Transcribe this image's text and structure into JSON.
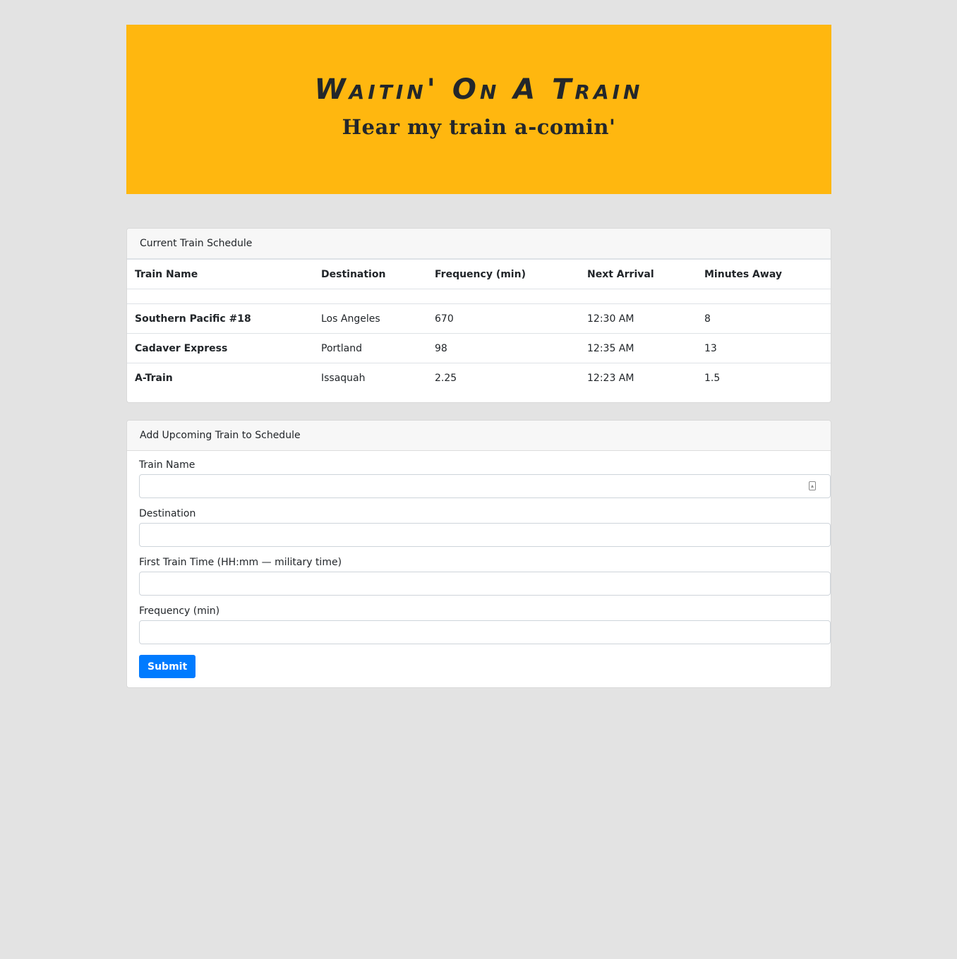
{
  "header": {
    "title": "Waitin' On A Train",
    "subtitle": "Hear my train a-comin'"
  },
  "schedule": {
    "heading": "Current Train Schedule",
    "columns": [
      "Train Name",
      "Destination",
      "Frequency (min)",
      "Next Arrival",
      "Minutes Away"
    ],
    "rows": [
      {
        "name": "Southern Pacific #18",
        "destination": "Los Angeles",
        "frequency": "670",
        "next_arrival": "12:30 AM",
        "minutes_away": "8"
      },
      {
        "name": "Cadaver Express",
        "destination": "Portland",
        "frequency": "98",
        "next_arrival": "12:35 AM",
        "minutes_away": "13"
      },
      {
        "name": "A-Train",
        "destination": "Issaquah",
        "frequency": "2.25",
        "next_arrival": "12:23 AM",
        "minutes_away": "1.5"
      }
    ]
  },
  "form": {
    "heading": "Add Upcoming Train to Schedule",
    "train_name_label": "Train Name",
    "train_name_value": "",
    "destination_label": "Destination",
    "destination_value": "",
    "first_time_label": "First Train Time (HH:mm — military time)",
    "first_time_value": "",
    "frequency_label": "Frequency (min)",
    "frequency_value": "",
    "submit_label": "Submit",
    "autofill_icon": "contact-card-icon"
  },
  "colors": {
    "banner": "#ffb70f",
    "background": "#e3e3e3",
    "primary": "#007bff"
  }
}
